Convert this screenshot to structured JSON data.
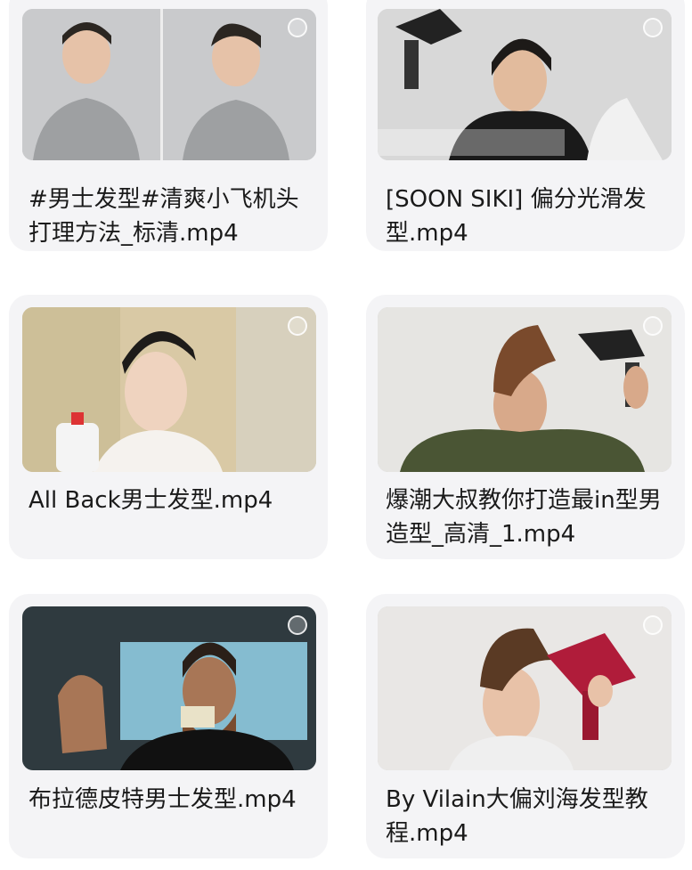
{
  "videos": [
    {
      "title": "#男士发型#清爽小飞机头打理方法_标清.mp4",
      "icon": "video-thumbnail"
    },
    {
      "title": "[SOON SIKI] 偏分光滑发型.mp4",
      "icon": "video-thumbnail"
    },
    {
      "title": "All Back男士发型.mp4",
      "icon": "video-thumbnail"
    },
    {
      "title": "爆潮大叔教你打造最in型男造型_高清_1.mp4",
      "icon": "video-thumbnail"
    },
    {
      "title": "布拉德皮特男士发型.mp4",
      "icon": "video-thumbnail"
    },
    {
      "title": "By Vilain大偏刘海发型教程.mp4",
      "icon": "video-thumbnail"
    }
  ]
}
